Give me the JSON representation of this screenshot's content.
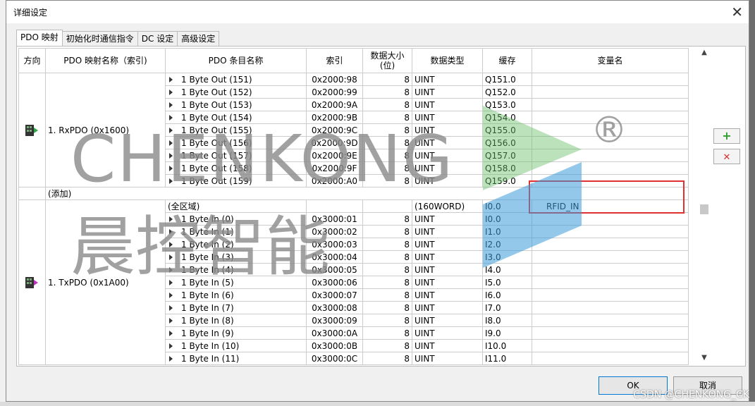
{
  "dialog": {
    "title": "详细设定",
    "tabs": [
      "PDO 映射",
      "初始化时通信指令",
      "DC 设定",
      "高级设定"
    ],
    "ok_label": "OK",
    "cancel_label": "取消"
  },
  "table": {
    "headers": [
      "方向",
      "PDO 映射名称（索引)",
      "PDO 条目名称",
      "索引",
      "数据大小\n(位)",
      "数据类型",
      "缓存",
      "变量名"
    ],
    "rx_group": {
      "name": "1. RxPDO (0x1600)",
      "rows": [
        {
          "entry": "1 Byte Out (151)",
          "index": "0x2000:98",
          "size": "8",
          "type": "UINT",
          "cache": "Q151.0",
          "var": ""
        },
        {
          "entry": "1 Byte Out (152)",
          "index": "0x2000:99",
          "size": "8",
          "type": "UINT",
          "cache": "Q152.0",
          "var": ""
        },
        {
          "entry": "1 Byte Out (153)",
          "index": "0x2000:9A",
          "size": "8",
          "type": "UINT",
          "cache": "Q153.0",
          "var": ""
        },
        {
          "entry": "1 Byte Out (154)",
          "index": "0x2000:9B",
          "size": "8",
          "type": "UINT",
          "cache": "Q154.0",
          "var": ""
        },
        {
          "entry": "1 Byte Out (155)",
          "index": "0x2000:9C",
          "size": "8",
          "type": "UINT",
          "cache": "Q155.0",
          "var": ""
        },
        {
          "entry": "1 Byte Out (156)",
          "index": "0x2000:9D",
          "size": "8",
          "type": "UINT",
          "cache": "Q156.0",
          "var": ""
        },
        {
          "entry": "1 Byte Out (157)",
          "index": "0x2000:9E",
          "size": "8",
          "type": "UINT",
          "cache": "Q157.0",
          "var": ""
        },
        {
          "entry": "1 Byte Out (158)",
          "index": "0x2000:9F",
          "size": "8",
          "type": "UINT",
          "cache": "Q158.0",
          "var": ""
        },
        {
          "entry": "1 Byte Out (159)",
          "index": "0x2000:A0",
          "size": "8",
          "type": "UINT",
          "cache": "Q159.0",
          "var": ""
        }
      ],
      "add_label": "(添加)"
    },
    "tx_group": {
      "name": "1. TxPDO (0x1A00)",
      "area": {
        "entry": "(全区域)",
        "type": "(160WORD)",
        "cache": "I0.0",
        "var": "RFID_IN"
      },
      "rows": [
        {
          "entry": "1 Byte In (0)",
          "index": "0x3000:01",
          "size": "8",
          "type": "UINT",
          "cache": "I0.0",
          "var": ""
        },
        {
          "entry": "1 Byte In (1)",
          "index": "0x3000:02",
          "size": "8",
          "type": "UINT",
          "cache": "I1.0",
          "var": ""
        },
        {
          "entry": "1 Byte In (2)",
          "index": "0x3000:03",
          "size": "8",
          "type": "UINT",
          "cache": "I2.0",
          "var": ""
        },
        {
          "entry": "1 Byte In (3)",
          "index": "0x3000:04",
          "size": "8",
          "type": "UINT",
          "cache": "I3.0",
          "var": ""
        },
        {
          "entry": "1 Byte In (4)",
          "index": "0x3000:05",
          "size": "8",
          "type": "UINT",
          "cache": "I4.0",
          "var": ""
        },
        {
          "entry": "1 Byte In (5)",
          "index": "0x3000:06",
          "size": "8",
          "type": "UINT",
          "cache": "I5.0",
          "var": ""
        },
        {
          "entry": "1 Byte In (6)",
          "index": "0x3000:07",
          "size": "8",
          "type": "UINT",
          "cache": "I6.0",
          "var": ""
        },
        {
          "entry": "1 Byte In (7)",
          "index": "0x3000:08",
          "size": "8",
          "type": "UINT",
          "cache": "I7.0",
          "var": ""
        },
        {
          "entry": "1 Byte In (8)",
          "index": "0x3000:09",
          "size": "8",
          "type": "UINT",
          "cache": "I8.0",
          "var": ""
        },
        {
          "entry": "1 Byte In (9)",
          "index": "0x3000:0A",
          "size": "8",
          "type": "UINT",
          "cache": "I9.0",
          "var": ""
        },
        {
          "entry": "1 Byte In (10)",
          "index": "0x3000:0B",
          "size": "8",
          "type": "UINT",
          "cache": "I10.0",
          "var": ""
        },
        {
          "entry": "1 Byte In (11)",
          "index": "0x3000:0C",
          "size": "8",
          "type": "UINT",
          "cache": "I11.0",
          "var": ""
        }
      ]
    }
  },
  "side_buttons": {
    "add_icon": "plus-icon",
    "remove_icon": "close-icon",
    "add_color": "#2e9e2e",
    "remove_color": "#d03030"
  },
  "watermark": {
    "en": "CHENKONG",
    "cn": "晨控智能",
    "reg": "®"
  },
  "credit": "CSDN @CHENKONG_CK"
}
